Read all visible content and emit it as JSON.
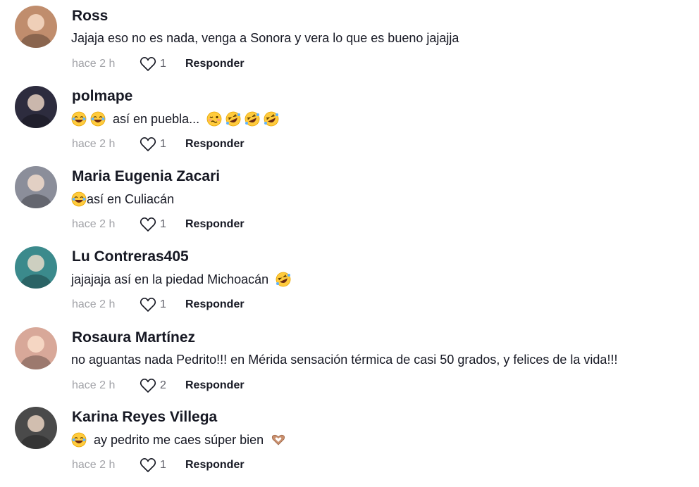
{
  "comments": [
    {
      "username": "Ross",
      "avatar_color": "#c08d6d",
      "segments": [
        {
          "t": "Jajaja eso no es nada, venga a Sonora y vera lo que es bueno jajajja"
        }
      ],
      "time": "hace 2 h",
      "likes": "1",
      "reply": "Responder"
    },
    {
      "username": "polmape",
      "avatar_color": "#2d2c3e",
      "segments": [
        {
          "e": "laughing"
        },
        {
          "t": " "
        },
        {
          "e": "laughing"
        },
        {
          "t": "  así en puebla...  "
        },
        {
          "e": "woozy"
        },
        {
          "t": " "
        },
        {
          "e": "rofl"
        },
        {
          "t": " "
        },
        {
          "e": "rofl"
        },
        {
          "t": " "
        },
        {
          "e": "rofl"
        }
      ],
      "time": "hace 2 h",
      "likes": "1",
      "reply": "Responder"
    },
    {
      "username": "Maria Eugenia Zacari",
      "avatar_color": "#8b8e9a",
      "segments": [
        {
          "e": "laughing"
        },
        {
          "t": "así en Culiacán"
        }
      ],
      "time": "hace 2 h",
      "likes": "1",
      "reply": "Responder"
    },
    {
      "username": "Lu Contreras405",
      "avatar_color": "#3b8a8c",
      "segments": [
        {
          "t": "jajajaja así en la piedad Michoacán  "
        },
        {
          "e": "rofl"
        }
      ],
      "time": "hace 2 h",
      "likes": "1",
      "reply": "Responder"
    },
    {
      "username": "Rosaura Martínez",
      "avatar_color": "#d8a899",
      "segments": [
        {
          "t": "no aguantas nada Pedrito!!! en Mérida sensación térmica de casi 50 grados, y felices de la vida!!!"
        }
      ],
      "time": "hace 2 h",
      "likes": "2",
      "reply": "Responder"
    },
    {
      "username": "Karina Reyes Villega",
      "avatar_color": "#4a4a4a",
      "segments": [
        {
          "e": "laughing"
        },
        {
          "t": "  ay pedrito me caes súper bien  "
        },
        {
          "e": "heart-hands"
        }
      ],
      "time": "hace 2 h",
      "likes": "1",
      "reply": "Responder"
    }
  ]
}
